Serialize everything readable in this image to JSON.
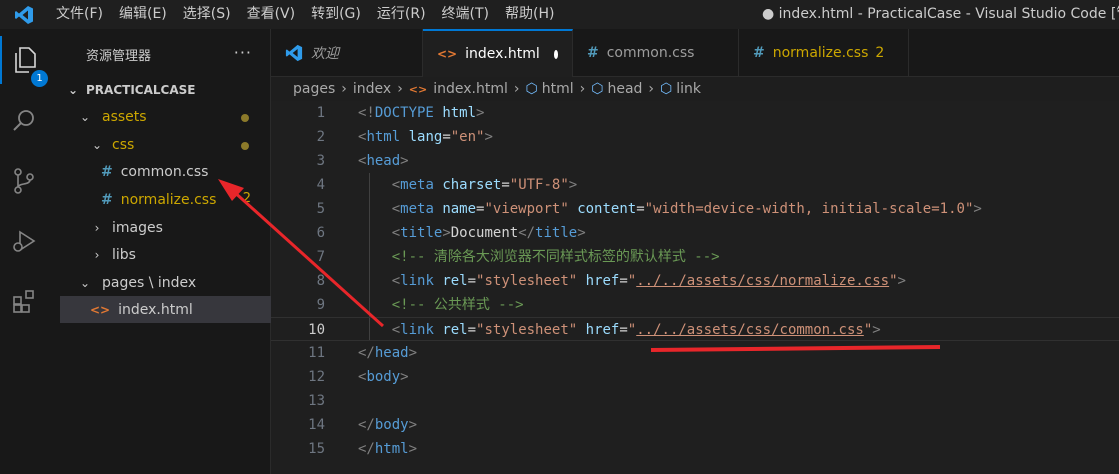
{
  "titlebar": {
    "menu": [
      "文件(F)",
      "编辑(E)",
      "选择(S)",
      "查看(V)",
      "转到(G)",
      "运行(R)",
      "终端(T)",
      "帮助(H)"
    ],
    "window_title": "● index.html - PracticalCase - Visual Studio Code [管理"
  },
  "activitybar": {
    "icons": [
      "explorer-icon",
      "search-icon",
      "source-control-icon",
      "run-debug-icon",
      "extensions-icon"
    ],
    "explorer_badge": "1"
  },
  "sidebar": {
    "title": "资源管理器",
    "more": "···",
    "project": "PRACTICALCASE",
    "items": [
      {
        "label": "assets",
        "type": "folder",
        "open": true
      },
      {
        "label": "css",
        "type": "folder",
        "open": true
      },
      {
        "label": "common.css",
        "type": "css"
      },
      {
        "label": "normalize.css",
        "type": "css",
        "problems": "2"
      },
      {
        "label": "images",
        "type": "folder",
        "open": false
      },
      {
        "label": "libs",
        "type": "folder",
        "open": false
      },
      {
        "label": "pages \\ index",
        "type": "folder",
        "open": true
      },
      {
        "label": "index.html",
        "type": "html"
      }
    ]
  },
  "tabs": [
    {
      "label": "欢迎",
      "icon": "vscode-icon"
    },
    {
      "label": "index.html",
      "icon": "html-icon",
      "active": true,
      "modified": true
    },
    {
      "label": "common.css",
      "icon": "css-icon"
    },
    {
      "label": "normalize.css",
      "icon": "css-icon",
      "problems": "2"
    }
  ],
  "breadcrumb": [
    "pages",
    "index",
    "index.html",
    "html",
    "head",
    "link"
  ],
  "editor": {
    "current_line": 10,
    "lines": [
      {
        "n": "1",
        "tokens": [
          [
            "brk",
            "<!"
          ],
          [
            "tag",
            "DOCTYPE"
          ],
          [
            "txt",
            " "
          ],
          [
            "attr",
            "html"
          ],
          [
            "brk",
            ">"
          ]
        ]
      },
      {
        "n": "2",
        "tokens": [
          [
            "brk",
            "<"
          ],
          [
            "tag",
            "html"
          ],
          [
            "txt",
            " "
          ],
          [
            "attr",
            "lang"
          ],
          [
            "txt",
            "="
          ],
          [
            "str",
            "\"en\""
          ],
          [
            "brk",
            ">"
          ]
        ]
      },
      {
        "n": "3",
        "tokens": [
          [
            "brk",
            "<"
          ],
          [
            "tag",
            "head"
          ],
          [
            "brk",
            ">"
          ]
        ]
      },
      {
        "n": "4",
        "tokens": [
          [
            "txt",
            "    "
          ],
          [
            "brk",
            "<"
          ],
          [
            "tag",
            "meta"
          ],
          [
            "txt",
            " "
          ],
          [
            "attr",
            "charset"
          ],
          [
            "txt",
            "="
          ],
          [
            "str",
            "\"UTF-8\""
          ],
          [
            "brk",
            ">"
          ]
        ]
      },
      {
        "n": "5",
        "tokens": [
          [
            "txt",
            "    "
          ],
          [
            "brk",
            "<"
          ],
          [
            "tag",
            "meta"
          ],
          [
            "txt",
            " "
          ],
          [
            "attr",
            "name"
          ],
          [
            "txt",
            "="
          ],
          [
            "str",
            "\"viewport\""
          ],
          [
            "txt",
            " "
          ],
          [
            "attr",
            "content"
          ],
          [
            "txt",
            "="
          ],
          [
            "str",
            "\"width=device-width, initial-scale=1.0\""
          ],
          [
            "brk",
            ">"
          ]
        ]
      },
      {
        "n": "6",
        "tokens": [
          [
            "txt",
            "    "
          ],
          [
            "brk",
            "<"
          ],
          [
            "tag",
            "title"
          ],
          [
            "brk",
            ">"
          ],
          [
            "txt",
            "Document"
          ],
          [
            "brk",
            "</"
          ],
          [
            "tag",
            "title"
          ],
          [
            "brk",
            ">"
          ]
        ]
      },
      {
        "n": "7",
        "tokens": [
          [
            "txt",
            "    "
          ],
          [
            "com",
            "<!-- 清除各大浏览器不同样式标签的默认样式 -->"
          ]
        ]
      },
      {
        "n": "8",
        "tokens": [
          [
            "txt",
            "    "
          ],
          [
            "brk",
            "<"
          ],
          [
            "tag",
            "link"
          ],
          [
            "txt",
            " "
          ],
          [
            "attr",
            "rel"
          ],
          [
            "txt",
            "="
          ],
          [
            "str",
            "\"stylesheet\""
          ],
          [
            "txt",
            " "
          ],
          [
            "attr",
            "href"
          ],
          [
            "txt",
            "="
          ],
          [
            "str",
            "\""
          ],
          [
            "url",
            "../../assets/css/normalize.css"
          ],
          [
            "str",
            "\""
          ],
          [
            "brk",
            ">"
          ]
        ]
      },
      {
        "n": "9",
        "tokens": [
          [
            "txt",
            "    "
          ],
          [
            "com",
            "<!-- 公共样式 -->"
          ]
        ]
      },
      {
        "n": "10",
        "tokens": [
          [
            "txt",
            "    "
          ],
          [
            "brk",
            "<"
          ],
          [
            "tag",
            "link"
          ],
          [
            "txt",
            " "
          ],
          [
            "attr",
            "rel"
          ],
          [
            "txt",
            "="
          ],
          [
            "str",
            "\"stylesheet\""
          ],
          [
            "txt",
            " "
          ],
          [
            "attr",
            "href"
          ],
          [
            "txt",
            "="
          ],
          [
            "str",
            "\""
          ],
          [
            "url",
            "../../assets/css/common.css"
          ],
          [
            "str",
            "\""
          ],
          [
            "brk",
            ">"
          ]
        ]
      },
      {
        "n": "11",
        "tokens": [
          [
            "brk",
            "</"
          ],
          [
            "tag",
            "head"
          ],
          [
            "brk",
            ">"
          ]
        ]
      },
      {
        "n": "12",
        "tokens": [
          [
            "brk",
            "<"
          ],
          [
            "tag",
            "body"
          ],
          [
            "brk",
            ">"
          ]
        ]
      },
      {
        "n": "13",
        "tokens": []
      },
      {
        "n": "14",
        "tokens": [
          [
            "brk",
            "</"
          ],
          [
            "tag",
            "body"
          ],
          [
            "brk",
            ">"
          ]
        ]
      },
      {
        "n": "15",
        "tokens": [
          [
            "brk",
            "</"
          ],
          [
            "tag",
            "html"
          ],
          [
            "brk",
            ">"
          ]
        ]
      }
    ]
  },
  "colors": {
    "accent": "#0078d4",
    "annotation_red": "#e8262a",
    "warning_yellow": "#cca700"
  }
}
